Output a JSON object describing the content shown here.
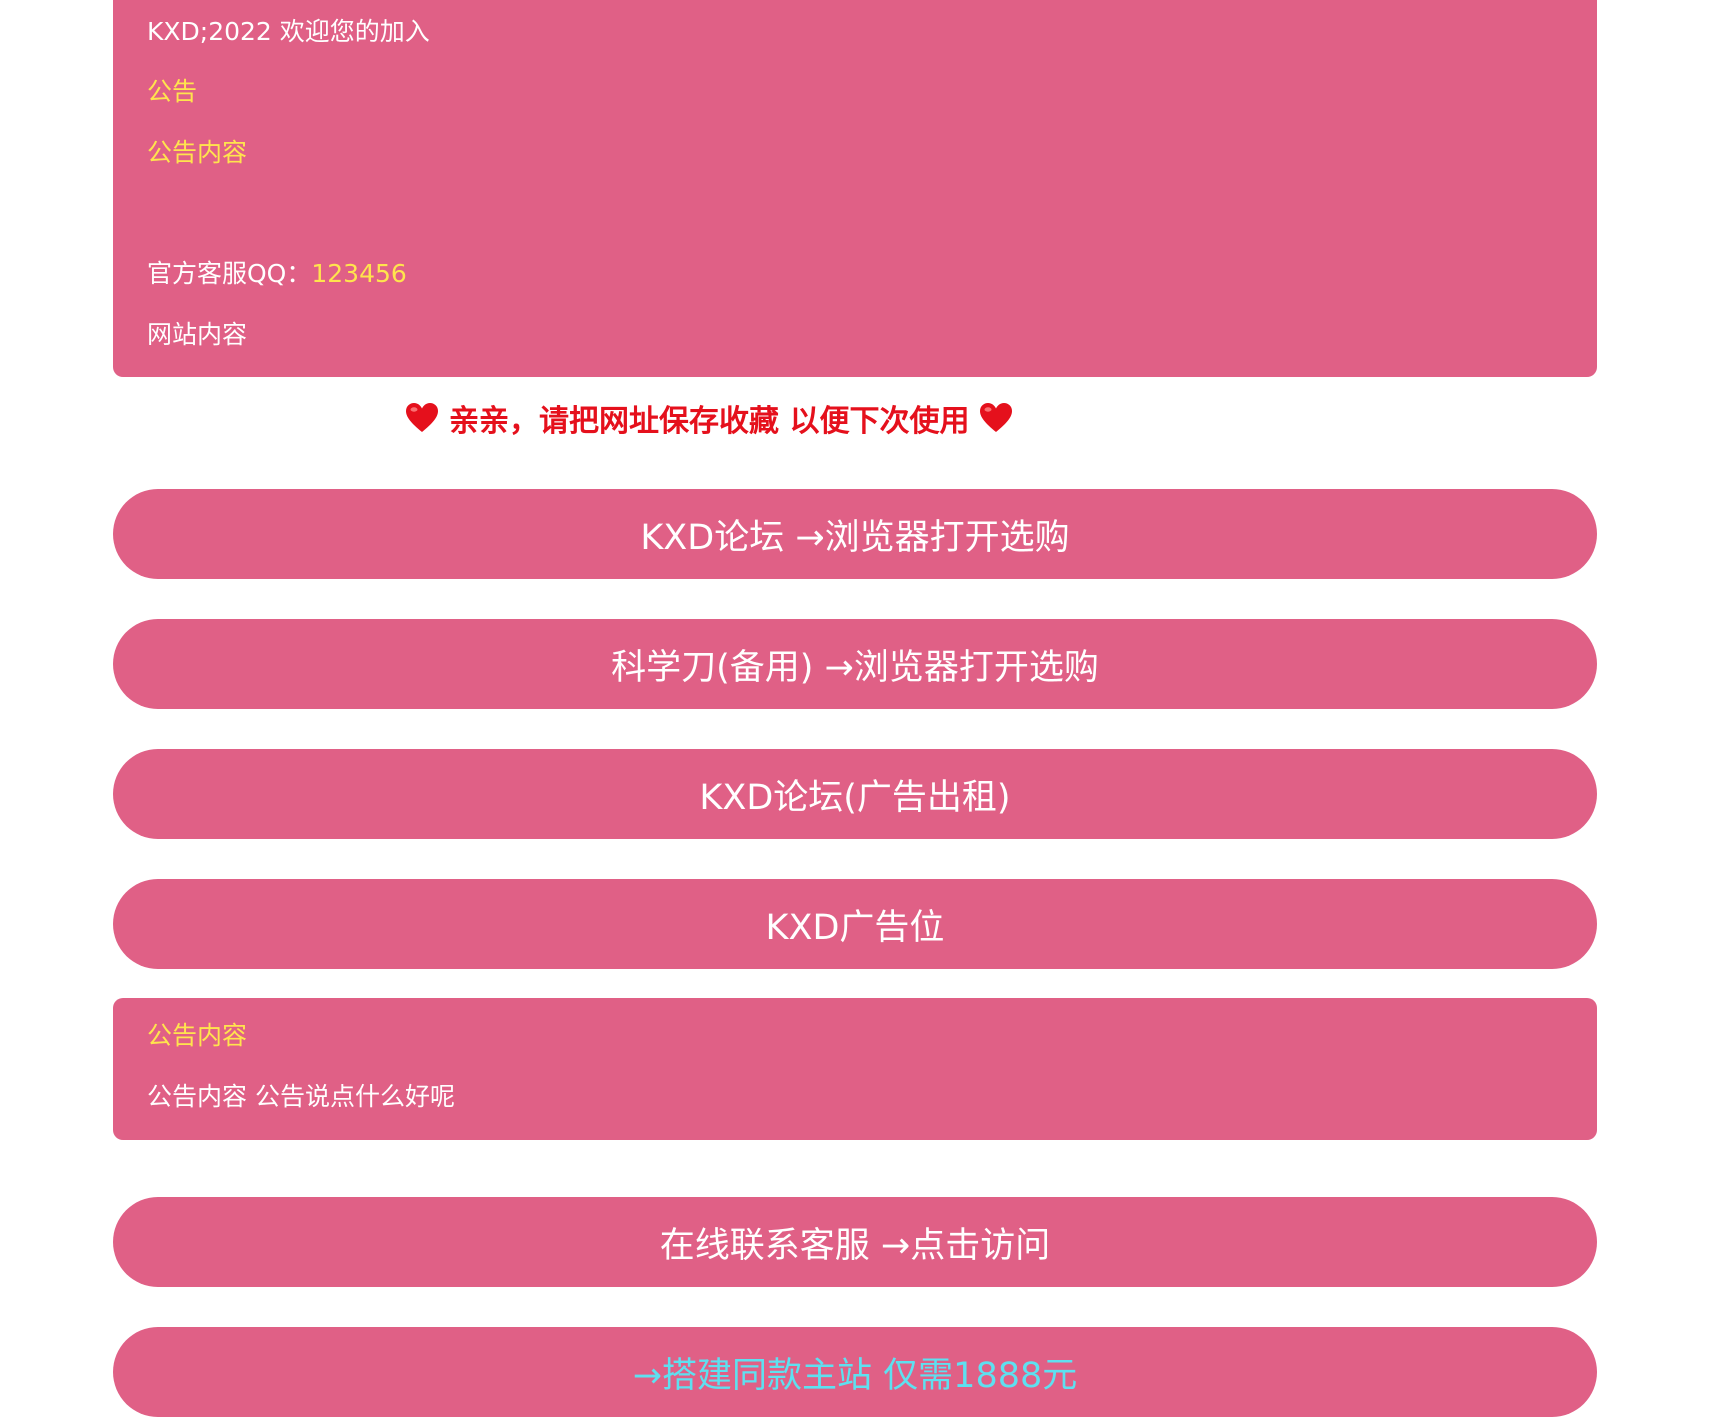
{
  "top_panel": {
    "welcome": "KXD;2022 欢迎您的加入",
    "notice_heading": "公告",
    "notice_content": "公告内容",
    "qq_label": "官方客服QQ：",
    "qq_number": "123456",
    "site_content": "网站内容"
  },
  "reminder": {
    "text": "亲亲，请把网址保存收藏 以便下次使用",
    "icon": "heart-icon"
  },
  "buttons": [
    {
      "label": "KXD论坛 →浏览器打开选购"
    },
    {
      "label": "科学刀(备用) →浏览器打开选购"
    },
    {
      "label": "KXD论坛(广告出租)"
    },
    {
      "label": "KXD广告位"
    }
  ],
  "notice_panel": {
    "heading": "公告内容",
    "body": "公告内容 公告说点什么好呢"
  },
  "bottom_buttons": [
    {
      "label": "在线联系客服 →点击访问"
    },
    {
      "label": "→搭建同款主站 仅需1888元"
    }
  ],
  "colors": {
    "panel": "#e06086",
    "heading_text": "#ffe44d",
    "reminder_text": "#e5101c",
    "highlight_button_text": "#5ee0f0"
  }
}
